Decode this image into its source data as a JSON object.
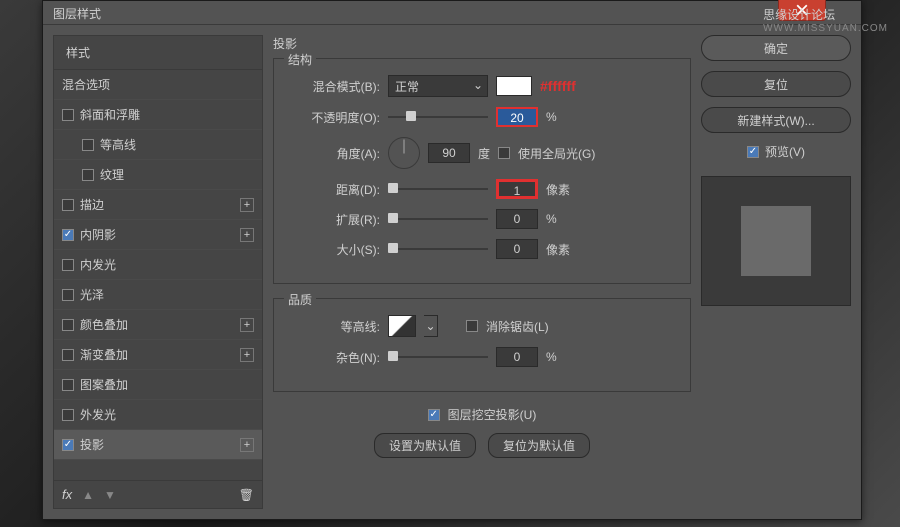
{
  "watermark": {
    "line1": "思缘设计论坛",
    "line2": "WWW.MISSYUAN.COM"
  },
  "dialog": {
    "title": "图层样式"
  },
  "sidebar": {
    "header": "样式",
    "blending": "混合选项",
    "items": [
      {
        "label": "斜面和浮雕",
        "checked": false,
        "plus": false
      },
      {
        "label": "等高线",
        "checked": false,
        "sub": true
      },
      {
        "label": "纹理",
        "checked": false,
        "sub": true
      },
      {
        "label": "描边",
        "checked": false,
        "plus": true
      },
      {
        "label": "内阴影",
        "checked": true,
        "plus": true
      },
      {
        "label": "内发光",
        "checked": false,
        "plus": false
      },
      {
        "label": "光泽",
        "checked": false,
        "plus": false
      },
      {
        "label": "颜色叠加",
        "checked": false,
        "plus": true
      },
      {
        "label": "渐变叠加",
        "checked": false,
        "plus": true
      },
      {
        "label": "图案叠加",
        "checked": false,
        "plus": false
      },
      {
        "label": "外发光",
        "checked": false,
        "plus": false
      },
      {
        "label": "投影",
        "checked": true,
        "plus": true,
        "selected": true
      }
    ],
    "fx": "fx"
  },
  "main": {
    "title": "投影",
    "structure": {
      "title": "结构",
      "blend_label": "混合模式(B):",
      "blend_value": "正常",
      "hex": "#ffffff",
      "swatch": "#ffffff",
      "opacity_label": "不透明度(O):",
      "opacity_value": "20",
      "opacity_unit": "%",
      "angle_label": "角度(A):",
      "angle_value": "90",
      "angle_unit": "度",
      "global_label": "使用全局光(G)",
      "global_checked": false,
      "distance_label": "距离(D):",
      "distance_value": "1",
      "distance_unit": "像素",
      "spread_label": "扩展(R):",
      "spread_value": "0",
      "spread_unit": "%",
      "size_label": "大小(S):",
      "size_value": "0",
      "size_unit": "像素"
    },
    "quality": {
      "title": "品质",
      "contour_label": "等高线:",
      "antialias_label": "消除锯齿(L)",
      "antialias_checked": false,
      "noise_label": "杂色(N):",
      "noise_value": "0",
      "noise_unit": "%"
    },
    "knockout": {
      "label": "图层挖空投影(U)",
      "checked": true
    },
    "buttons": {
      "default": "设置为默认值",
      "reset": "复位为默认值"
    }
  },
  "right": {
    "ok": "确定",
    "cancel": "复位",
    "newstyle": "新建样式(W)...",
    "preview_label": "预览(V)",
    "preview_checked": true
  }
}
